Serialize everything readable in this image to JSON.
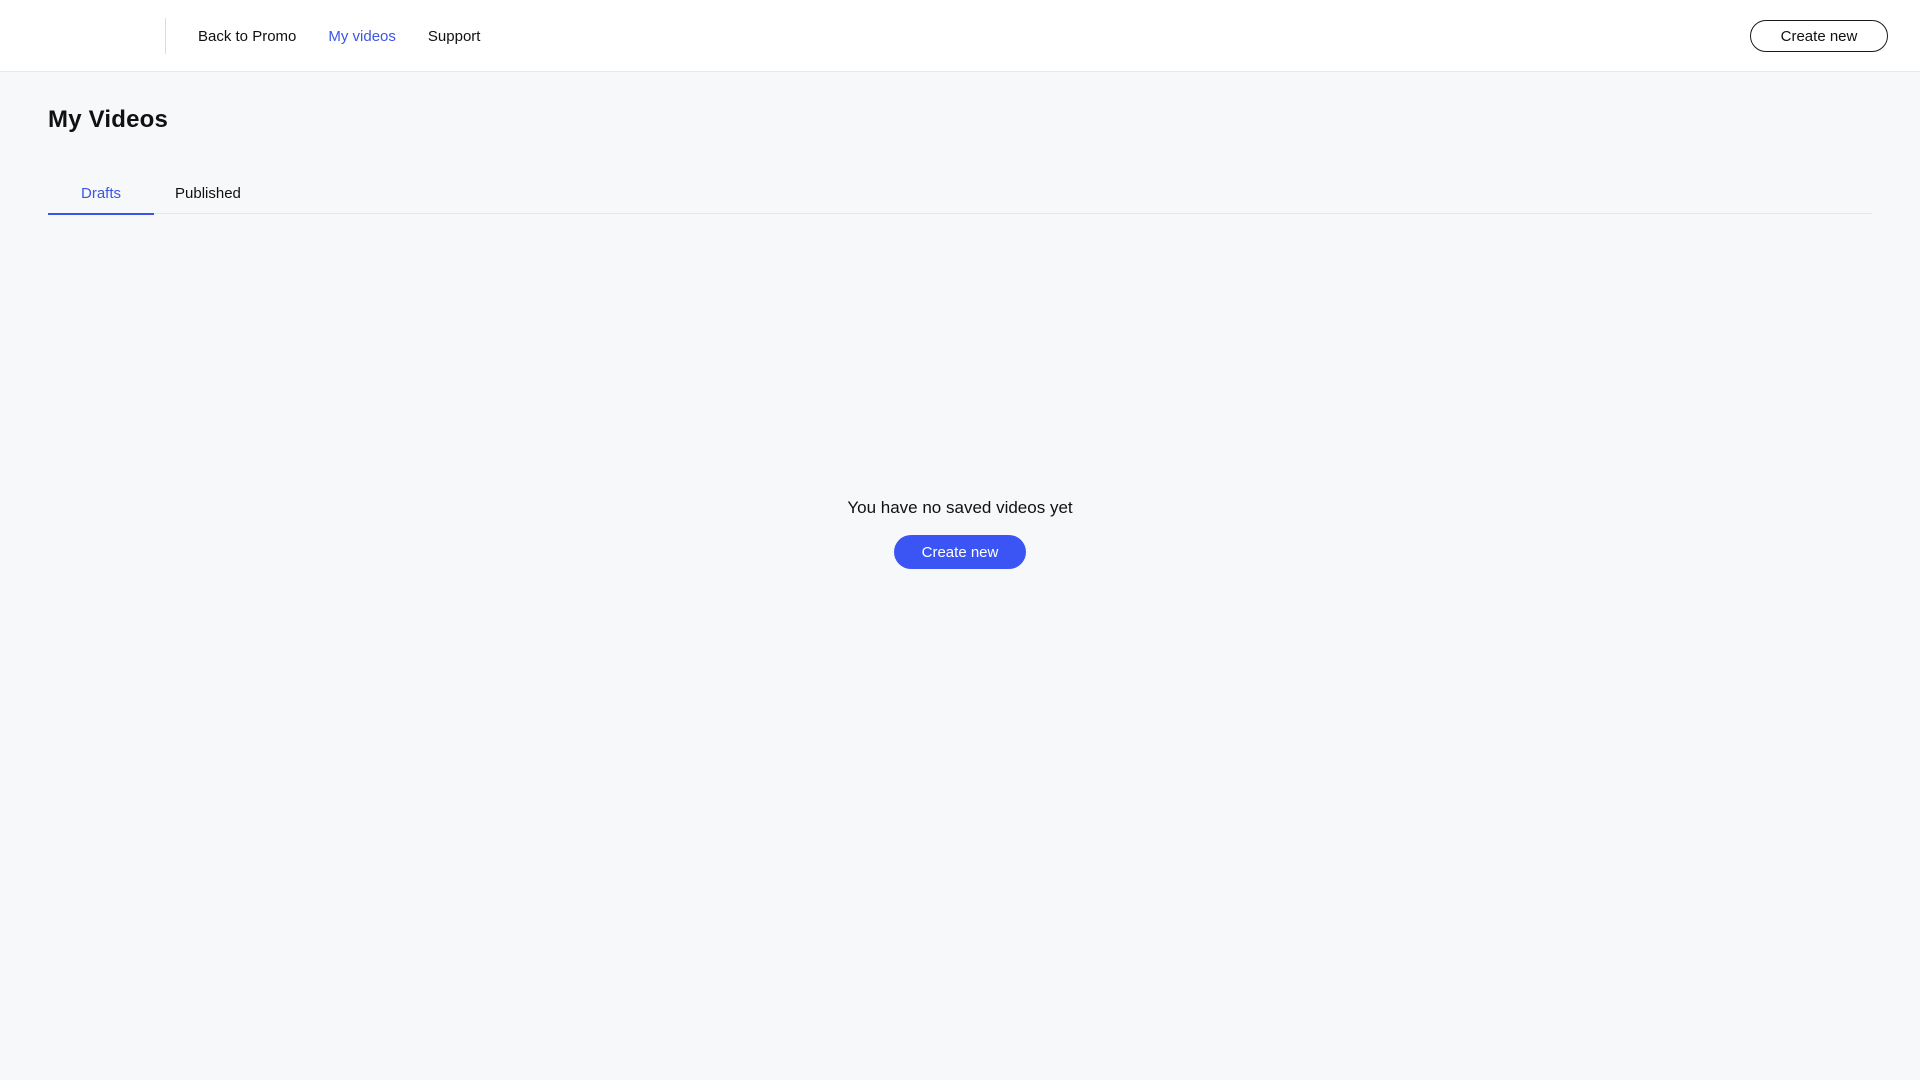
{
  "header": {
    "nav": [
      {
        "label": "Back to Promo",
        "active": false
      },
      {
        "label": "My videos",
        "active": true
      },
      {
        "label": "Support",
        "active": false
      }
    ],
    "create_label": "Create new"
  },
  "page": {
    "title": "My Videos",
    "tabs": [
      {
        "label": "Drafts",
        "active": true
      },
      {
        "label": "Published",
        "active": false
      }
    ]
  },
  "empty_state": {
    "message": "You have no saved videos yet",
    "button_label": "Create new"
  },
  "colors": {
    "accent": "#3b55e6",
    "button_fill": "#3b55f4",
    "background": "#f7f8fa",
    "header_background": "#ffffff"
  }
}
